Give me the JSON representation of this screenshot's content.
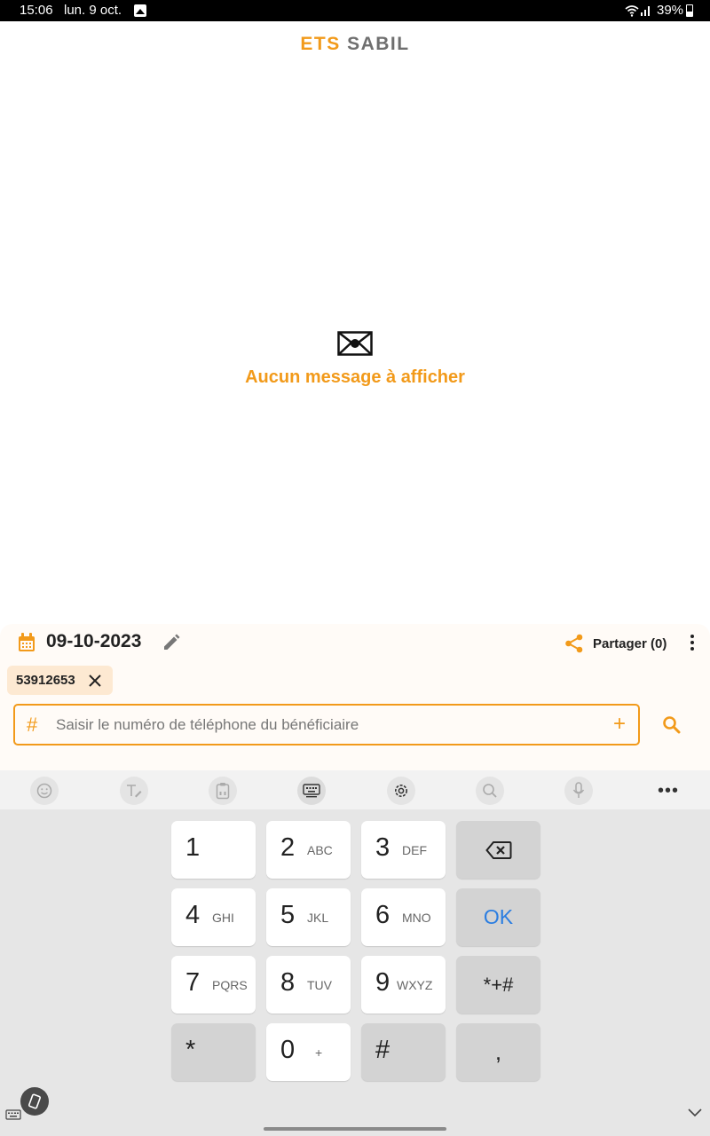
{
  "status_bar": {
    "time": "15:06",
    "date": "lun. 9 oct.",
    "battery": "39%"
  },
  "app": {
    "title_part1": "ETS",
    "title_part2": "SABIL",
    "accent_color": "#F29A1A"
  },
  "empty_state": {
    "icon": "envelope-icon",
    "message": "Aucun message à afficher"
  },
  "panel": {
    "date": "09-10-2023",
    "share_label": "Partager (0)",
    "chip_number": "53912653",
    "phone_placeholder": "Saisir le numéro de téléphone du bénéficiaire",
    "phone_value": ""
  },
  "keyboard": {
    "toolbar_icons": [
      "emoji-icon",
      "handwriting-icon",
      "clipboard-icon",
      "keyboard-icon",
      "settings-icon",
      "search-icon",
      "microphone-icon",
      "more-icon"
    ],
    "keys": [
      {
        "num": "1",
        "sub": ""
      },
      {
        "num": "2",
        "sub": "ABC"
      },
      {
        "num": "3",
        "sub": "DEF"
      },
      {
        "num": "4",
        "sub": "GHI"
      },
      {
        "num": "5",
        "sub": "JKL"
      },
      {
        "num": "6",
        "sub": "MNO"
      },
      {
        "num": "7",
        "sub": "PQRS"
      },
      {
        "num": "8",
        "sub": "TUV"
      },
      {
        "num": "9",
        "sub": "WXYZ"
      },
      {
        "num": "*",
        "sub": ""
      },
      {
        "num": "0",
        "sub": "+"
      },
      {
        "num": "#",
        "sub": ""
      }
    ],
    "backspace": "backspace-icon",
    "ok_label": "OK",
    "symbols_label": "*+#",
    "comma_label": ","
  }
}
